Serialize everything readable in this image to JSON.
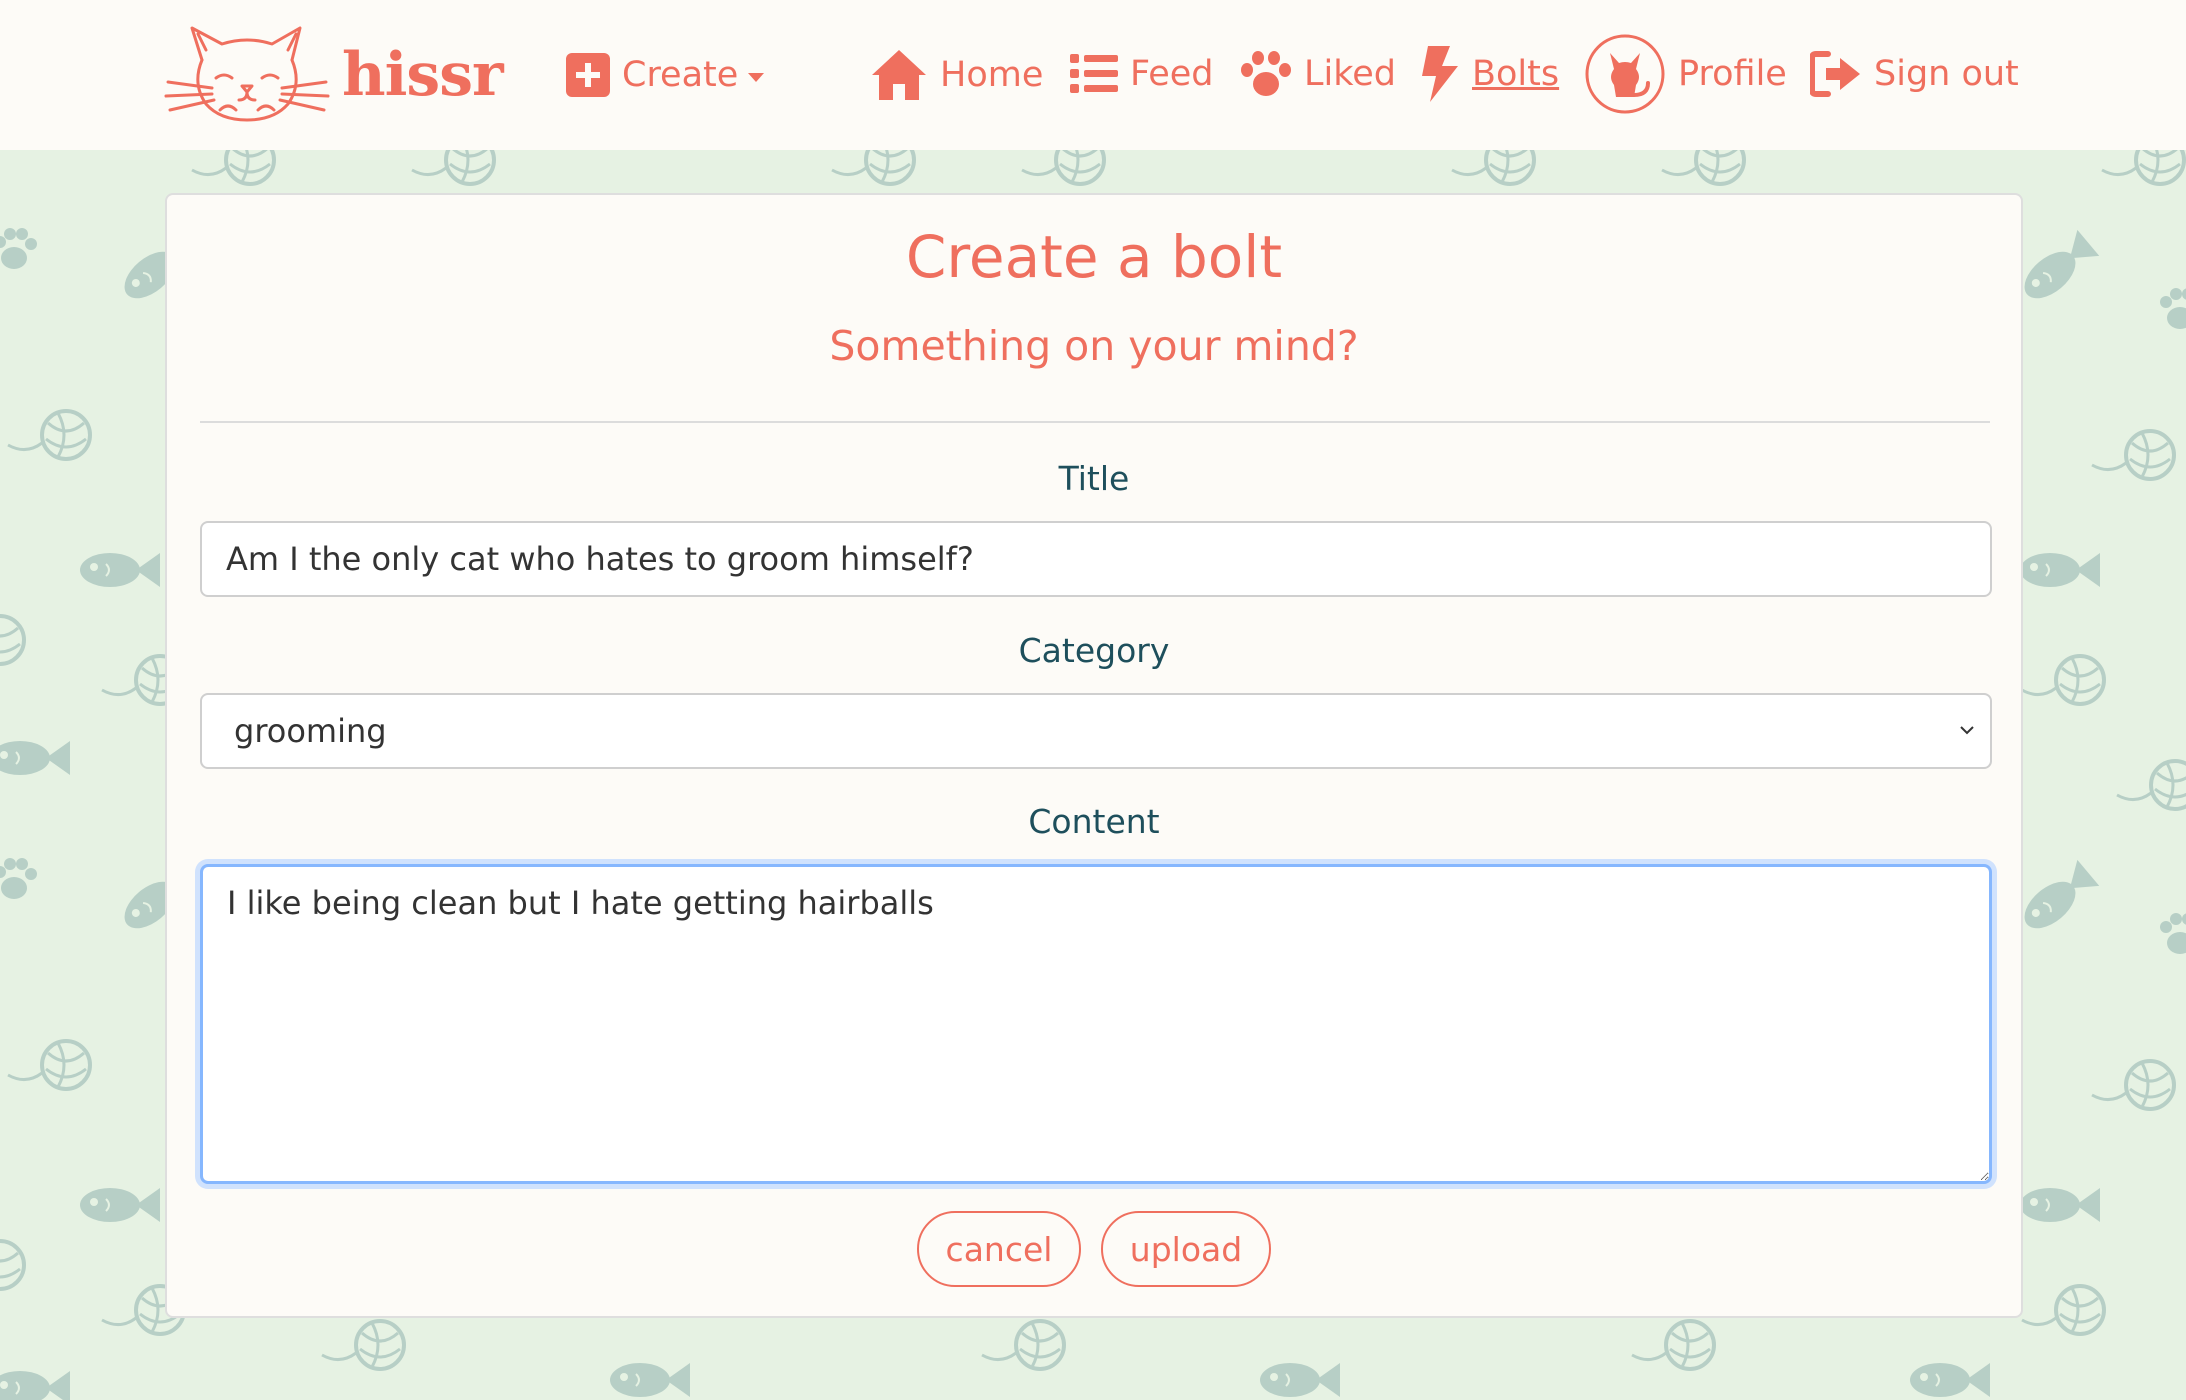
{
  "brand": {
    "name": "hissr"
  },
  "nav": {
    "create": {
      "label": "Create",
      "icon": "plus-square-icon"
    },
    "home": {
      "label": "Home",
      "icon": "home-icon"
    },
    "feed": {
      "label": "Feed",
      "icon": "list-icon"
    },
    "liked": {
      "label": "Liked",
      "icon": "paw-icon"
    },
    "bolts": {
      "label": "Bolts",
      "icon": "bolt-icon",
      "active": true
    },
    "profile": {
      "label": "Profile",
      "icon": "cat-avatar-icon"
    },
    "signout": {
      "label": "Sign out",
      "icon": "sign-out-icon"
    }
  },
  "form": {
    "title": "Create a bolt",
    "subtitle": "Something on your mind?",
    "title_field": {
      "label": "Title",
      "value": "Am I the only cat who hates to groom himself?"
    },
    "category_field": {
      "label": "Category",
      "value": "grooming",
      "options": [
        "grooming"
      ]
    },
    "content_field": {
      "label": "Content",
      "value": "I like being clean but I hate getting hairballs"
    },
    "cancel_label": "cancel",
    "upload_label": "upload"
  },
  "colors": {
    "accent": "#ef6f5e",
    "label_text": "#1e4f5c",
    "background": "#e6f2e3",
    "card": "#fdfbf7",
    "pattern": "#b7cfc6",
    "focus": "#86b7fe"
  }
}
